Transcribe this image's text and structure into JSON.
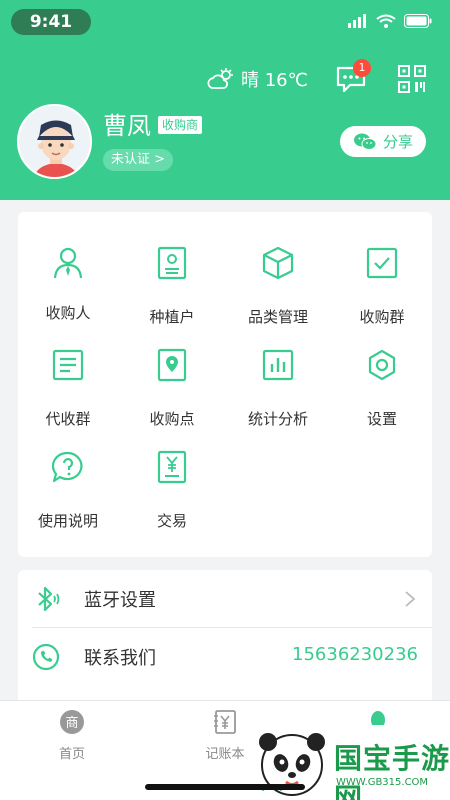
{
  "status_bar": {
    "time": "9:41"
  },
  "header": {
    "weather_text": "晴 16℃",
    "message_badge": "1",
    "user_name": "曹凤",
    "role_tag": "收购商",
    "verify_label": "未认证 >",
    "share_label": "分享"
  },
  "grid": {
    "items": [
      {
        "label": "收购人",
        "icon": "person-icon"
      },
      {
        "label": "种植户",
        "icon": "id-card-icon"
      },
      {
        "label": "品类管理",
        "icon": "box-icon"
      },
      {
        "label": "收购群",
        "icon": "checkbox-icon"
      },
      {
        "label": "代收群",
        "icon": "list-doc-icon"
      },
      {
        "label": "收购点",
        "icon": "location-pin-icon"
      },
      {
        "label": "统计分析",
        "icon": "bar-chart-icon"
      },
      {
        "label": "设置",
        "icon": "gear-icon"
      },
      {
        "label": "使用说明",
        "icon": "help-bubble-icon"
      },
      {
        "label": "交易",
        "icon": "receipt-yen-icon"
      }
    ]
  },
  "list": {
    "bluetooth_label": "蓝牙设置",
    "contact_label": "联系我们",
    "contact_phone": "15636230236"
  },
  "tabbar": {
    "tabs": [
      {
        "label": "首页",
        "icon": "shop-icon"
      },
      {
        "label": "记账本",
        "icon": "ledger-icon"
      }
    ]
  },
  "watermark": {
    "name": "国宝手游网",
    "url": "WWW.GB315.COM"
  },
  "colors": {
    "brand": "#38cc8f",
    "badge": "#ff4b3a"
  }
}
